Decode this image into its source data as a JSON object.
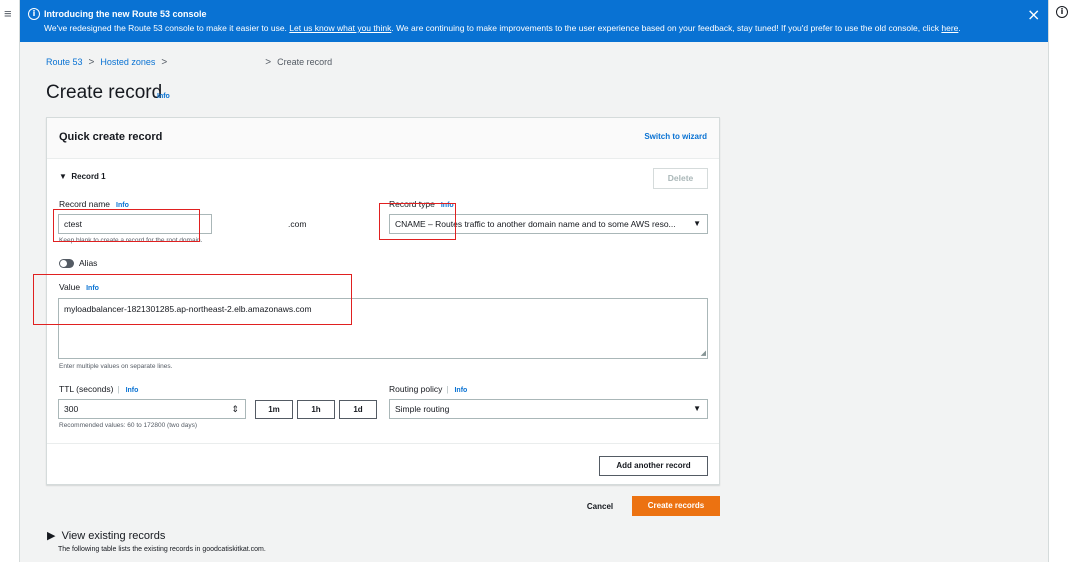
{
  "banner": {
    "title": "Introducing the new Route 53 console",
    "text_before_link": "We've redesigned the Route 53 console to make it easier to use. ",
    "feedback_link": "Let us know what you think",
    "text_middle": ". We are continuing to make improvements to the user experience based on your feedback, stay tuned! If you'd prefer to use the old console, click ",
    "here_link": "here",
    "text_end": ".",
    "close_icon": "×",
    "info_icon": "i"
  },
  "nav": {
    "menu_icon": "≡",
    "help_icon": "i"
  },
  "breadcrumb": {
    "items": [
      "Route 53",
      "Hosted zones"
    ],
    "current": "Create record",
    "separator": ">"
  },
  "page": {
    "title": "Create record",
    "info": "Info"
  },
  "panel": {
    "title": "Quick create record",
    "switch_link": "Switch to wizard",
    "record_section": "Record 1",
    "delete_label": "Delete",
    "record_name": {
      "label": "Record name",
      "info": "Info",
      "value": "ctest",
      "suffix": ".com",
      "hint": "Keep blank to create a record for the root domain."
    },
    "record_type": {
      "label": "Record type",
      "info": "Info",
      "value": "CNAME – Routes traffic to another domain name and to some AWS reso..."
    },
    "alias": {
      "label": "Alias",
      "enabled": false
    },
    "value_field": {
      "label": "Value",
      "info": "Info",
      "value": "myloadbalancer-1821301285.ap-northeast-2.elb.amazonaws.com",
      "hint": "Enter multiple values on separate lines."
    },
    "ttl": {
      "label": "TTL (seconds)",
      "info": "Info",
      "value": "300",
      "hint": "Recommended values: 60 to 172800 (two days)",
      "quick_buttons": [
        "1m",
        "1h",
        "1d"
      ]
    },
    "routing_policy": {
      "label": "Routing policy",
      "info": "Info",
      "value": "Simple routing"
    },
    "add_record_label": "Add another record"
  },
  "actions": {
    "cancel": "Cancel",
    "create": "Create records"
  },
  "existing_records": {
    "title": "View existing records",
    "description": "The following table lists the existing records in goodcatiskitkat.com."
  },
  "colors": {
    "banner": "#0972d3",
    "primary_button": "#ec7211",
    "link": "#0972d3",
    "annotation": "#e02020"
  }
}
